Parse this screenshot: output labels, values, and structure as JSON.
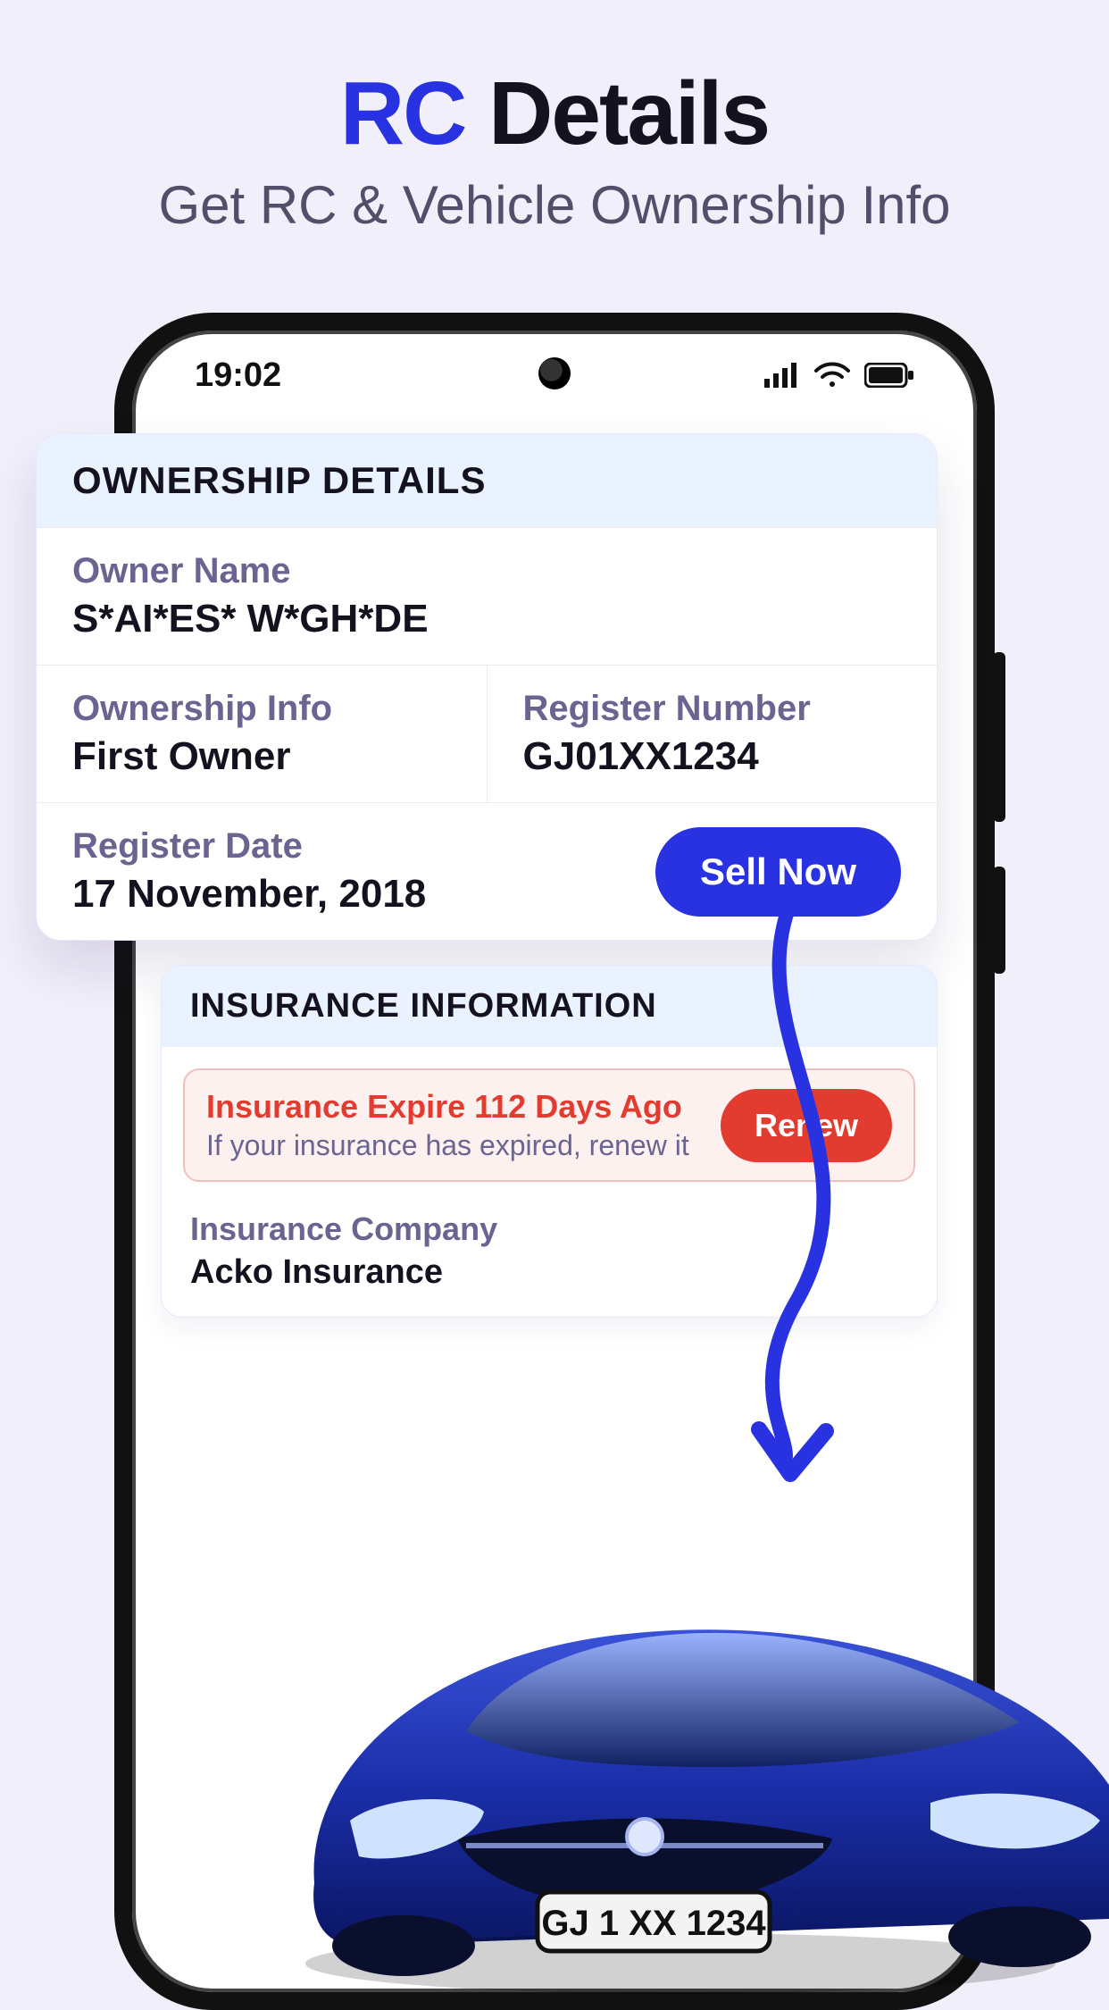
{
  "headline": {
    "accent": "RC",
    "rest": " Details",
    "sub": "Get RC & Vehicle Ownership Info"
  },
  "status": {
    "time": "19:02"
  },
  "ownership": {
    "title": "OWNERSHIP DETAILS",
    "owner_name_label": "Owner Name",
    "owner_name": "S*AI*ES* W*GH*DE",
    "ownership_info_label": "Ownership Info",
    "ownership_info": "First Owner",
    "register_number_label": "Register Number",
    "register_number": "GJ01XX1234",
    "register_date_label": "Register Date",
    "register_date": "17 November, 2018",
    "sell_button": "Sell Now"
  },
  "insurance": {
    "title": "INSURANCE INFORMATION",
    "alert_title": "Insurance Expire 112 Days Ago",
    "alert_sub": "If your insurance has expired, renew it",
    "renew_button": "Renew",
    "company_label": "Insurance Company",
    "company": "Acko Insurance"
  },
  "car": {
    "plate": "GJ 1 XX 1234"
  },
  "colors": {
    "accent_blue": "#2832e0",
    "danger": "#e23b30"
  }
}
